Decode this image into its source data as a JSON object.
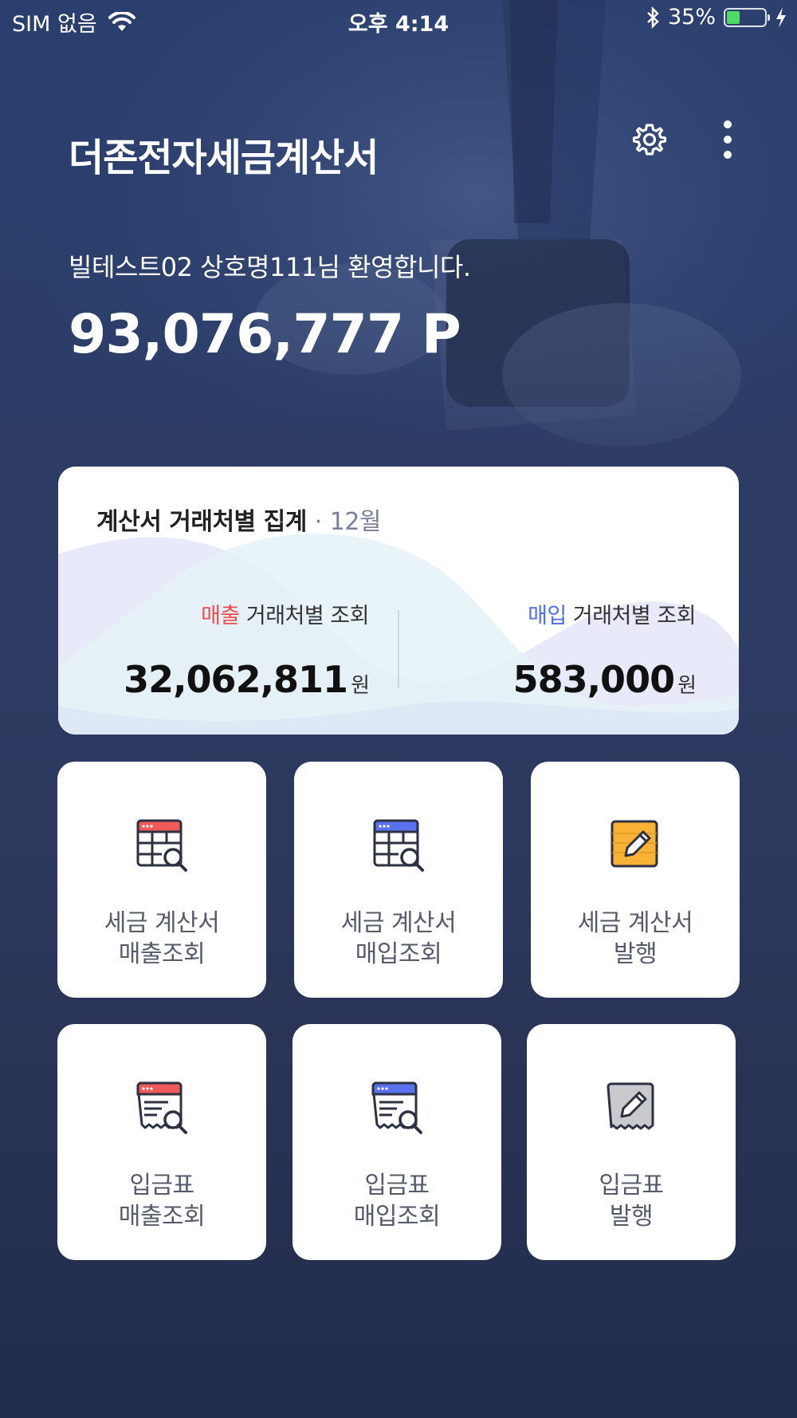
{
  "status_bar": {
    "carrier": "SIM 없음",
    "time": "오후 4:14",
    "battery_percent": "35%",
    "battery_level": 0.35
  },
  "header": {
    "app_title": "더존전자세금계산서",
    "settings_icon": "gear-icon",
    "more_icon": "kebab-menu-icon"
  },
  "welcome": {
    "message": "빌테스트02 상호명111님 환영합니다.",
    "points": "93,076,777 P"
  },
  "summary": {
    "title": "계산서 거래처별 집계",
    "separator": "·",
    "month": "12월",
    "sales": {
      "highlight": "매출",
      "label": " 거래처별 조회",
      "amount": "32,062,811",
      "unit": "원",
      "color": "#ef4b4b"
    },
    "purchase": {
      "highlight": "매입",
      "label": " 거래처별 조회",
      "amount": "583,000",
      "unit": "원",
      "color": "#4e6ef2"
    }
  },
  "tiles": [
    {
      "line1": "세금 계산서",
      "line2": "매출조회",
      "icon": "tax-invoice-sales-search-icon"
    },
    {
      "line1": "세금 계산서",
      "line2": "매입조회",
      "icon": "tax-invoice-purchase-search-icon"
    },
    {
      "line1": "세금 계산서",
      "line2": "발행",
      "icon": "tax-invoice-issue-icon"
    },
    {
      "line1": "입금표",
      "line2": "매출조회",
      "icon": "receipt-sales-search-icon"
    },
    {
      "line1": "입금표",
      "line2": "매입조회",
      "icon": "receipt-purchase-search-icon"
    },
    {
      "line1": "입금표",
      "line2": "발행",
      "icon": "receipt-issue-icon"
    }
  ]
}
